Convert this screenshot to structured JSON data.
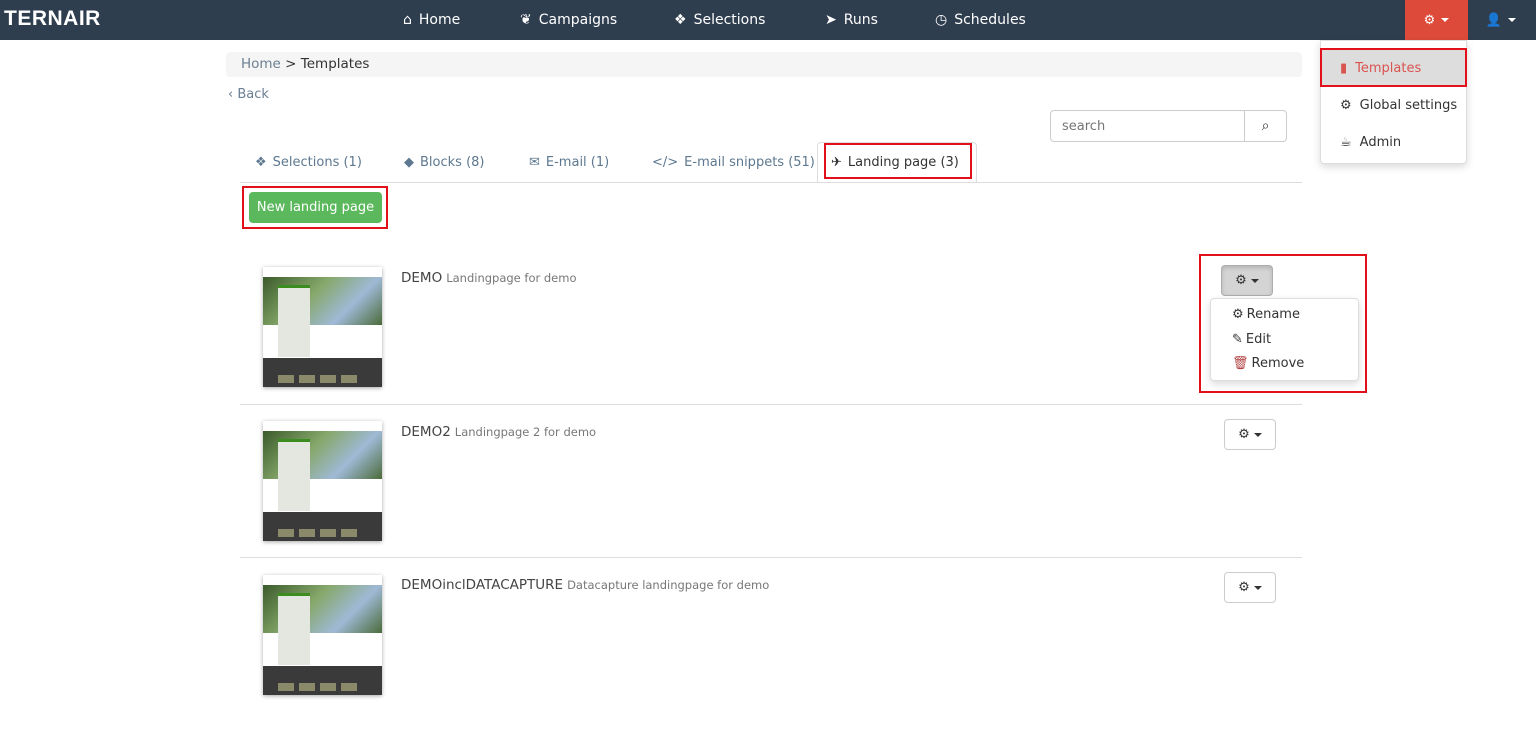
{
  "brand": {
    "logo": "TERNAIR"
  },
  "nav": {
    "items": [
      {
        "label": "Home",
        "icon": "home-icon"
      },
      {
        "label": "Campaigns",
        "icon": "leaf-icon"
      },
      {
        "label": "Selections",
        "icon": "cubes-icon"
      },
      {
        "label": "Runs",
        "icon": "paper-plane-icon"
      },
      {
        "label": "Schedules",
        "icon": "clock-icon"
      }
    ],
    "settings_menu": [
      {
        "label": "Templates",
        "icon": "file-icon"
      },
      {
        "label": "Global settings",
        "icon": "gear-icon"
      },
      {
        "label": "Admin",
        "icon": "coffee-icon"
      }
    ]
  },
  "breadcrumb": {
    "home": "Home",
    "sep": ">",
    "current": "Templates"
  },
  "back": {
    "label": "Back",
    "chevron": "‹"
  },
  "search": {
    "placeholder": "search"
  },
  "tabs": [
    {
      "label": "Selections (1)"
    },
    {
      "label": "Blocks (8)"
    },
    {
      "label": "E-mail (1)"
    },
    {
      "label": "E-mail snippets (51)"
    },
    {
      "label": "Landing page (3)"
    }
  ],
  "new_button": "New landing page",
  "items": [
    {
      "name": "DEMO",
      "description": "Landingpage for demo"
    },
    {
      "name": "DEMO2",
      "description": "Landingpage 2 for demo"
    },
    {
      "name": "DEMOinclDATACAPTURE",
      "description": "Datacapture landingpage for demo"
    }
  ],
  "item_menu": [
    {
      "label": "Rename"
    },
    {
      "label": "Edit"
    },
    {
      "label": "Remove"
    }
  ],
  "colors": {
    "navbar": "#2f3e4f",
    "accent_red": "#de4a3a",
    "green": "#5cb85c",
    "highlight": "#e2101a"
  }
}
